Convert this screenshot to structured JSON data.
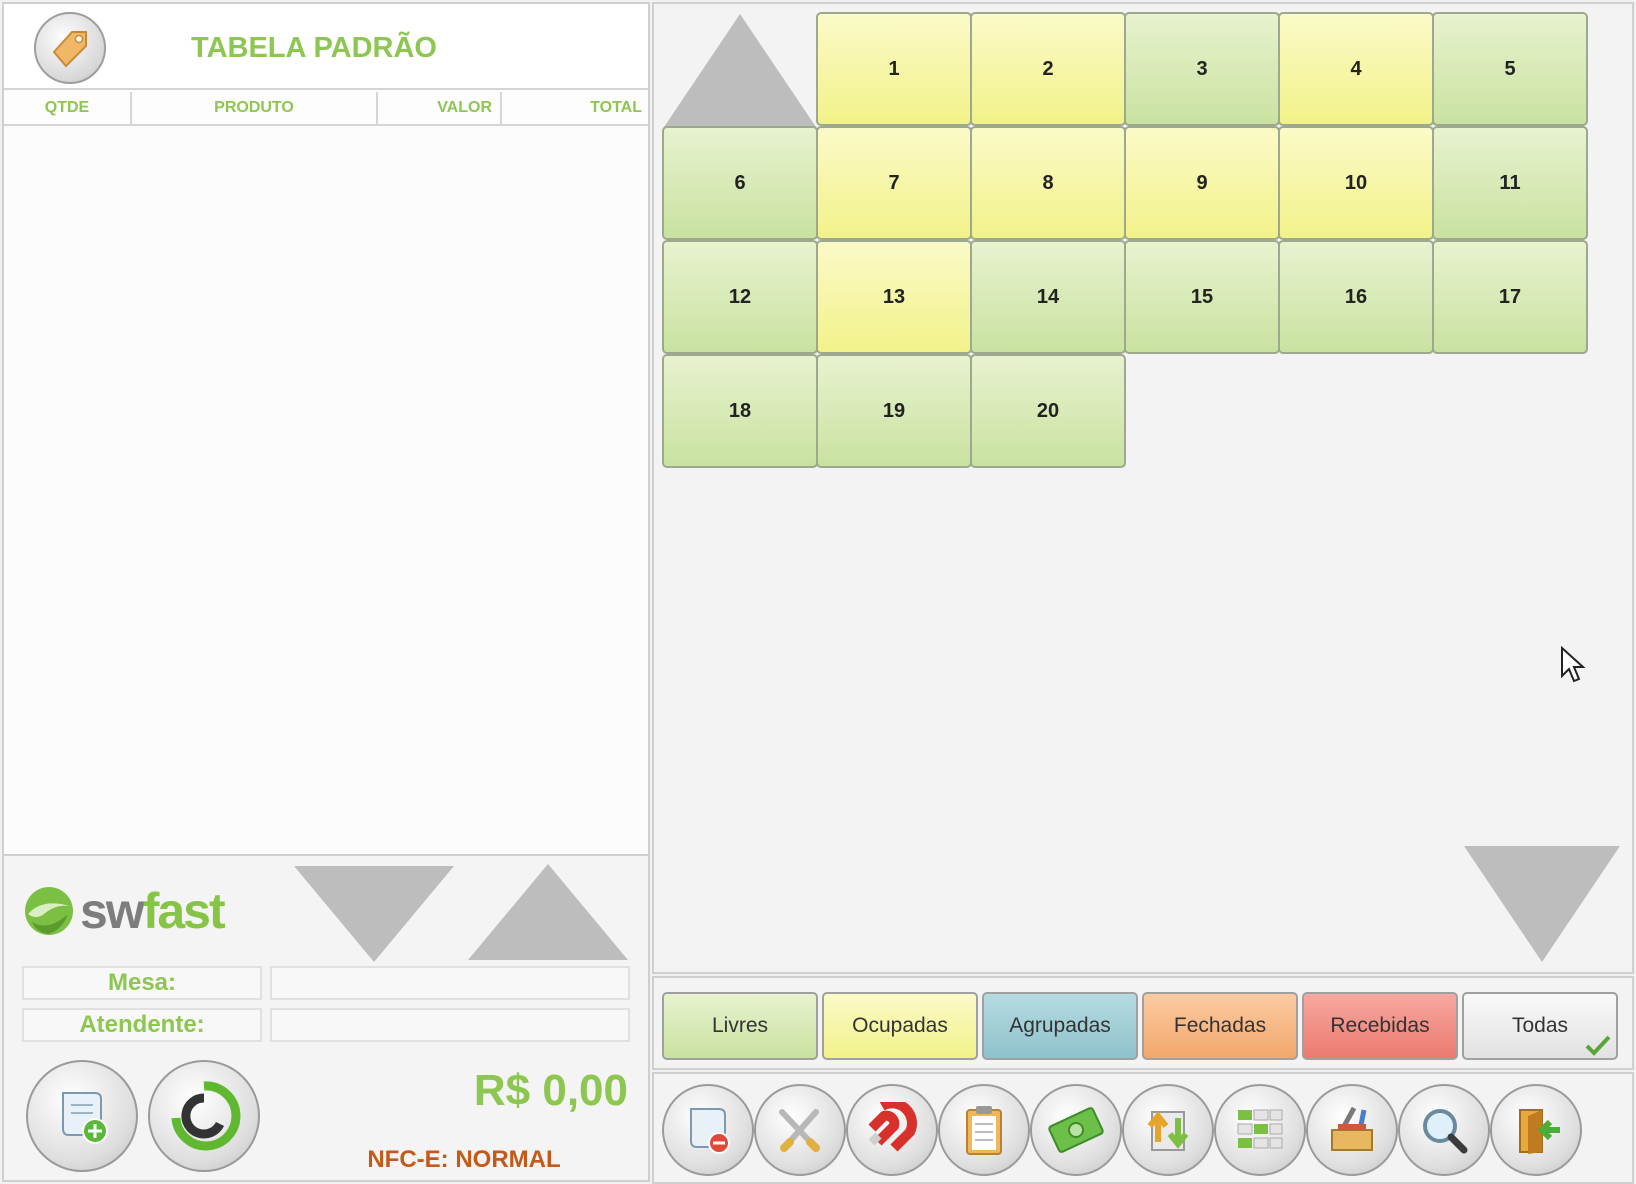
{
  "order": {
    "price_table_title": "TABELA PADRÃO",
    "columns": [
      "QTDE",
      "PRODUTO",
      "VALOR",
      "TOTAL"
    ],
    "fields": {
      "mesa_label": "Mesa:",
      "mesa_value": "",
      "atendente_label": "Atendente:",
      "atendente_value": ""
    },
    "total": "R$ 0,00",
    "nfce_status": "NFC-E: NORMAL"
  },
  "brand": {
    "part1": "sw",
    "part2": "fast"
  },
  "tables": [
    {
      "number": "1",
      "status": "occupied"
    },
    {
      "number": "2",
      "status": "occupied"
    },
    {
      "number": "3",
      "status": "free"
    },
    {
      "number": "4",
      "status": "occupied"
    },
    {
      "number": "5",
      "status": "free"
    },
    {
      "number": "6",
      "status": "free"
    },
    {
      "number": "7",
      "status": "occupied"
    },
    {
      "number": "8",
      "status": "occupied"
    },
    {
      "number": "9",
      "status": "occupied"
    },
    {
      "number": "10",
      "status": "occupied"
    },
    {
      "number": "11",
      "status": "free"
    },
    {
      "number": "12",
      "status": "free"
    },
    {
      "number": "13",
      "status": "occupied"
    },
    {
      "number": "14",
      "status": "free"
    },
    {
      "number": "15",
      "status": "free"
    },
    {
      "number": "16",
      "status": "free"
    },
    {
      "number": "17",
      "status": "free"
    },
    {
      "number": "18",
      "status": "free"
    },
    {
      "number": "19",
      "status": "free"
    },
    {
      "number": "20",
      "status": "free"
    }
  ],
  "filters": [
    "Livres",
    "Ocupadas",
    "Agrupadas",
    "Fechadas",
    "Recebidas",
    "Todas"
  ],
  "active_filter": "Todas",
  "colors": {
    "accent_green": "#8dc650",
    "free": "#c9e2a0",
    "occupied": "#f2f28a",
    "grouped": "#8fc2cc",
    "closed": "#f2a86c",
    "received": "#ec7a6f",
    "nfce": "#c45a1a"
  },
  "toolbar_icons": [
    "cancel-receipt-icon",
    "cutlery-icon",
    "magnet-icon",
    "clipboard-icon",
    "money-icon",
    "transfer-icon",
    "group-tables-icon",
    "tools-icon",
    "search-icon",
    "exit-icon"
  ]
}
